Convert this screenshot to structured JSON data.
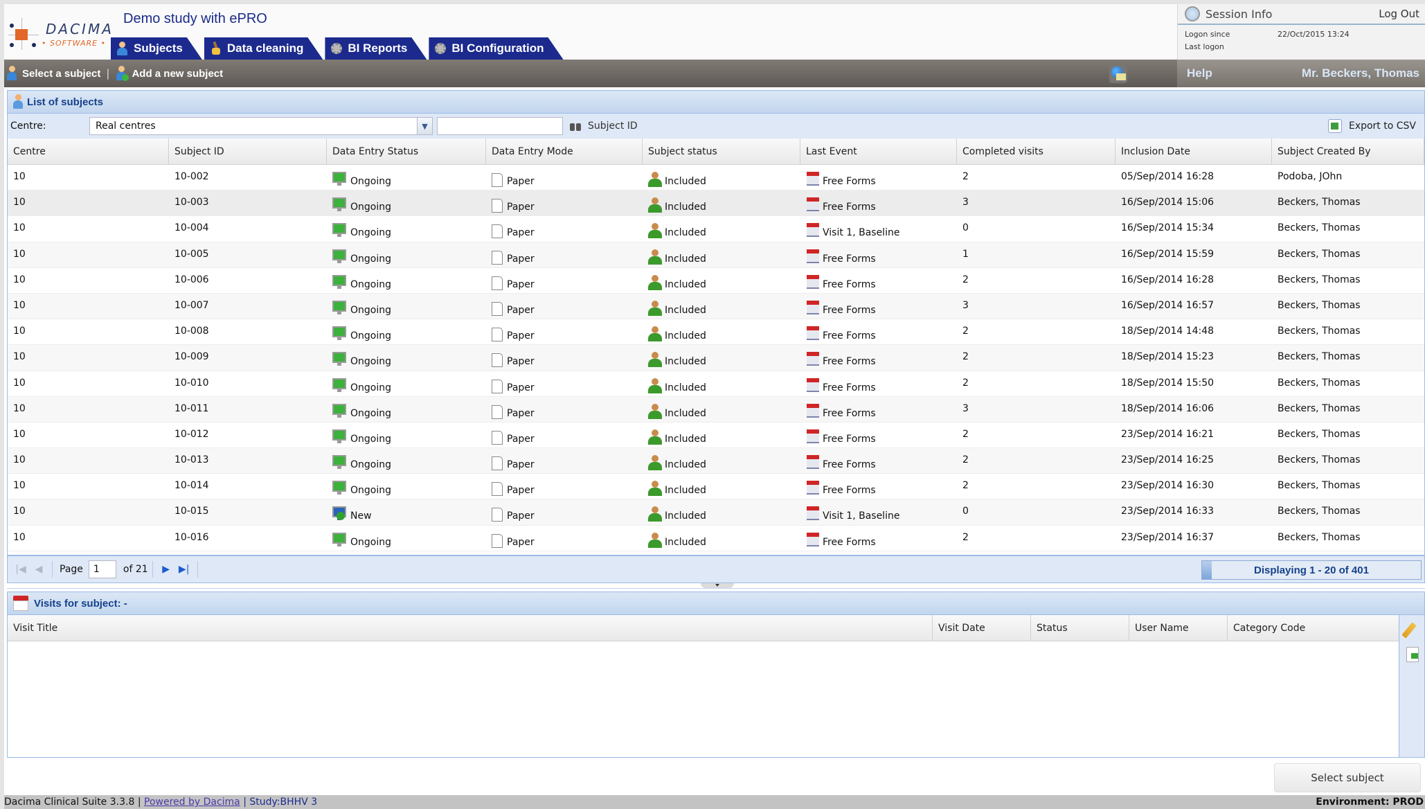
{
  "header": {
    "logo_top": "DACIMA",
    "logo_bottom": "• SOFTWARE •",
    "study_title": "Demo study with ePRO",
    "tabs": [
      {
        "label": "Subjects",
        "icon": "user-icon"
      },
      {
        "label": "Data cleaning",
        "icon": "broom-icon"
      },
      {
        "label": "BI Reports",
        "icon": "gear-icon"
      },
      {
        "label": "BI Configuration",
        "icon": "gear-icon"
      }
    ],
    "session": {
      "title": "Session Info",
      "logout": "Log Out",
      "logon_since_label": "Logon since",
      "logon_since_value": "22/Oct/2015 13:24",
      "last_logon_label": "Last logon",
      "last_logon_value": ""
    }
  },
  "toolbar": {
    "select_subject": "Select a subject",
    "separator": "|",
    "add_subject": "Add a new subject",
    "help": "Help",
    "user_name": "Mr. Beckers, Thomas"
  },
  "subjects_panel": {
    "title": "List of subjects",
    "centre_label": "Centre:",
    "centre_value": "Real centres",
    "subject_id_input": "",
    "subject_id_button": "Subject ID",
    "export_label": "Export to CSV",
    "columns": [
      "Centre",
      "Subject ID",
      "Data Entry Status",
      "Data Entry Mode",
      "Subject status",
      "Last Event",
      "Completed visits",
      "Inclusion Date",
      "Subject Created By"
    ],
    "rows": [
      {
        "centre": "10",
        "subject_id": "10-002",
        "entry_status": "Ongoing",
        "entry_mode": "Paper",
        "subject_status": "Included",
        "last_event": "Free Forms",
        "completed_visits": "2",
        "inclusion_date": "05/Sep/2014 16:28",
        "created_by": "Podoba, JOhn"
      },
      {
        "centre": "10",
        "subject_id": "10-003",
        "entry_status": "Ongoing",
        "entry_mode": "Paper",
        "subject_status": "Included",
        "last_event": "Free Forms",
        "completed_visits": "3",
        "inclusion_date": "16/Sep/2014 15:06",
        "created_by": "Beckers, Thomas"
      },
      {
        "centre": "10",
        "subject_id": "10-004",
        "entry_status": "Ongoing",
        "entry_mode": "Paper",
        "subject_status": "Included",
        "last_event": "Visit 1, Baseline",
        "completed_visits": "0",
        "inclusion_date": "16/Sep/2014 15:34",
        "created_by": "Beckers, Thomas"
      },
      {
        "centre": "10",
        "subject_id": "10-005",
        "entry_status": "Ongoing",
        "entry_mode": "Paper",
        "subject_status": "Included",
        "last_event": "Free Forms",
        "completed_visits": "1",
        "inclusion_date": "16/Sep/2014 15:59",
        "created_by": "Beckers, Thomas"
      },
      {
        "centre": "10",
        "subject_id": "10-006",
        "entry_status": "Ongoing",
        "entry_mode": "Paper",
        "subject_status": "Included",
        "last_event": "Free Forms",
        "completed_visits": "2",
        "inclusion_date": "16/Sep/2014 16:28",
        "created_by": "Beckers, Thomas"
      },
      {
        "centre": "10",
        "subject_id": "10-007",
        "entry_status": "Ongoing",
        "entry_mode": "Paper",
        "subject_status": "Included",
        "last_event": "Free Forms",
        "completed_visits": "3",
        "inclusion_date": "16/Sep/2014 16:57",
        "created_by": "Beckers, Thomas"
      },
      {
        "centre": "10",
        "subject_id": "10-008",
        "entry_status": "Ongoing",
        "entry_mode": "Paper",
        "subject_status": "Included",
        "last_event": "Free Forms",
        "completed_visits": "2",
        "inclusion_date": "18/Sep/2014 14:48",
        "created_by": "Beckers, Thomas"
      },
      {
        "centre": "10",
        "subject_id": "10-009",
        "entry_status": "Ongoing",
        "entry_mode": "Paper",
        "subject_status": "Included",
        "last_event": "Free Forms",
        "completed_visits": "2",
        "inclusion_date": "18/Sep/2014 15:23",
        "created_by": "Beckers, Thomas"
      },
      {
        "centre": "10",
        "subject_id": "10-010",
        "entry_status": "Ongoing",
        "entry_mode": "Paper",
        "subject_status": "Included",
        "last_event": "Free Forms",
        "completed_visits": "2",
        "inclusion_date": "18/Sep/2014 15:50",
        "created_by": "Beckers, Thomas"
      },
      {
        "centre": "10",
        "subject_id": "10-011",
        "entry_status": "Ongoing",
        "entry_mode": "Paper",
        "subject_status": "Included",
        "last_event": "Free Forms",
        "completed_visits": "3",
        "inclusion_date": "18/Sep/2014 16:06",
        "created_by": "Beckers, Thomas"
      },
      {
        "centre": "10",
        "subject_id": "10-012",
        "entry_status": "Ongoing",
        "entry_mode": "Paper",
        "subject_status": "Included",
        "last_event": "Free Forms",
        "completed_visits": "2",
        "inclusion_date": "23/Sep/2014 16:21",
        "created_by": "Beckers, Thomas"
      },
      {
        "centre": "10",
        "subject_id": "10-013",
        "entry_status": "Ongoing",
        "entry_mode": "Paper",
        "subject_status": "Included",
        "last_event": "Free Forms",
        "completed_visits": "2",
        "inclusion_date": "23/Sep/2014 16:25",
        "created_by": "Beckers, Thomas"
      },
      {
        "centre": "10",
        "subject_id": "10-014",
        "entry_status": "Ongoing",
        "entry_mode": "Paper",
        "subject_status": "Included",
        "last_event": "Free Forms",
        "completed_visits": "2",
        "inclusion_date": "23/Sep/2014 16:30",
        "created_by": "Beckers, Thomas"
      },
      {
        "centre": "10",
        "subject_id": "10-015",
        "entry_status": "New",
        "entry_mode": "Paper",
        "subject_status": "Included",
        "last_event": "Visit 1, Baseline",
        "completed_visits": "0",
        "inclusion_date": "23/Sep/2014 16:33",
        "created_by": "Beckers, Thomas"
      },
      {
        "centre": "10",
        "subject_id": "10-016",
        "entry_status": "Ongoing",
        "entry_mode": "Paper",
        "subject_status": "Included",
        "last_event": "Free Forms",
        "completed_visits": "2",
        "inclusion_date": "23/Sep/2014 16:37",
        "created_by": "Beckers, Thomas"
      }
    ],
    "pager": {
      "page_label": "Page",
      "page_value": "1",
      "of_label": "of 21",
      "display_info": "Displaying 1 - 20 of 401"
    }
  },
  "visits_panel": {
    "title": "Visits for subject: -",
    "columns": [
      "Visit Title",
      "Visit Date",
      "Status",
      "User Name",
      "Category Code"
    ]
  },
  "actions": {
    "select_subject_button": "Select subject"
  },
  "footer": {
    "version": "Dacima Clinical Suite 3.3.8 | ",
    "powered_by": "Powered by Dacima",
    "study": " | Study:BHHV 3",
    "environment": "Environment: PROD"
  },
  "colors": {
    "tab_bg": "#1c2a8e",
    "panel_title": "#15428b",
    "panel_bg": "#dfe8f6",
    "toolbar_bg": "#6e6964"
  }
}
